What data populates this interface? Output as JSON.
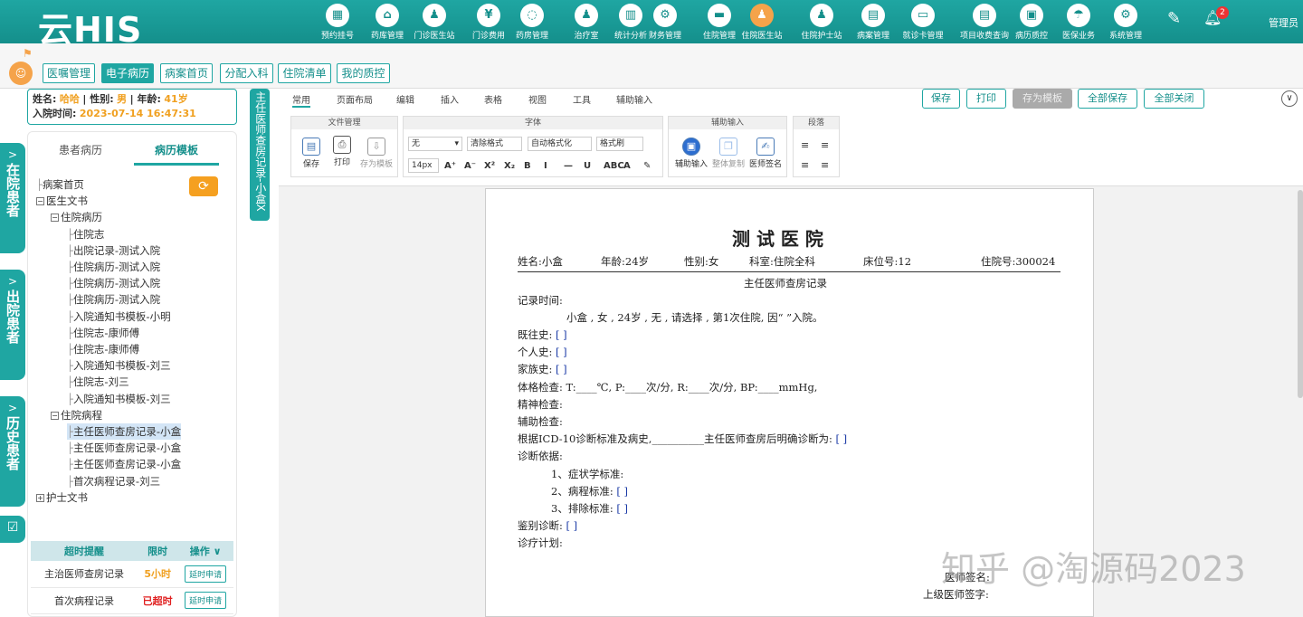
{
  "app": {
    "logo": "云HIS",
    "user": "管理员",
    "badge": "2"
  },
  "nav": [
    {
      "label": "预约挂号",
      "icon": "calendar-icon"
    },
    {
      "label": "药库管理",
      "icon": "warehouse-icon"
    },
    {
      "label": "门诊医生站",
      "icon": "doctor-icon"
    },
    {
      "label": "门诊费用",
      "icon": "yen-icon"
    },
    {
      "label": "药房管理",
      "icon": "pill-icon"
    },
    {
      "label": "治疗室",
      "icon": "nurse-icon"
    },
    {
      "label": "统计分析",
      "icon": "chart-icon"
    },
    {
      "label": "财务管理",
      "icon": "gear-money-icon"
    },
    {
      "label": "住院管理",
      "icon": "bed-icon"
    },
    {
      "label": "住院医生站",
      "icon": "inpatient-doctor-icon"
    },
    {
      "label": "住院护士站",
      "icon": "inpatient-nurse-icon"
    },
    {
      "label": "病案管理",
      "icon": "folder-icon"
    },
    {
      "label": "就诊卡管理",
      "icon": "card-icon"
    },
    {
      "label": "项目收费查询",
      "icon": "receipt-icon"
    },
    {
      "label": "病历质控",
      "icon": "clipboard-icon"
    },
    {
      "label": "医保业务",
      "icon": "insurance-icon"
    },
    {
      "label": "系统管理",
      "icon": "settings-icon"
    }
  ],
  "subtabs": [
    "医嘱管理",
    "电子病历",
    "病案首页",
    "分配入科",
    "住院清单",
    "我的质控"
  ],
  "patient": {
    "name_label": "姓名:",
    "name": "哈哈",
    "sex_label": "| 性别:",
    "sex": "男",
    "age_label": "| 年龄:",
    "age": "41岁",
    "admit_label": "入院时间:",
    "admit_time": "2023-07-14 16:47:31"
  },
  "side_tabs": [
    "在院患者",
    "出院患者",
    "历史患者"
  ],
  "left_tabs": [
    "患者病历",
    "病历模板"
  ],
  "tree": [
    {
      "label": "病案首页",
      "lvl": 0,
      "box": ""
    },
    {
      "label": "医生文书",
      "lvl": 0,
      "box": "⊟"
    },
    {
      "label": "住院病历",
      "lvl": 1,
      "box": "⊟"
    },
    {
      "label": "住院志",
      "lvl": 2,
      "box": ""
    },
    {
      "label": "出院记录-测试入院",
      "lvl": 2,
      "box": ""
    },
    {
      "label": "住院病历-测试入院",
      "lvl": 2,
      "box": ""
    },
    {
      "label": "住院病历-测试入院",
      "lvl": 2,
      "box": ""
    },
    {
      "label": "住院病历-测试入院",
      "lvl": 2,
      "box": ""
    },
    {
      "label": "入院通知书模板-小明",
      "lvl": 2,
      "box": ""
    },
    {
      "label": "住院志-康师傅",
      "lvl": 2,
      "box": ""
    },
    {
      "label": "住院志-康师傅",
      "lvl": 2,
      "box": ""
    },
    {
      "label": "入院通知书模板-刘三",
      "lvl": 2,
      "box": ""
    },
    {
      "label": "住院志-刘三",
      "lvl": 2,
      "box": ""
    },
    {
      "label": "入院通知书模板-刘三",
      "lvl": 2,
      "box": ""
    },
    {
      "label": "住院病程",
      "lvl": 1,
      "box": "⊟"
    },
    {
      "label": "主任医师查房记录-小盒",
      "lvl": 2,
      "box": "",
      "sel": true
    },
    {
      "label": "主任医师查房记录-小盒",
      "lvl": 2,
      "box": ""
    },
    {
      "label": "主任医师查房记录-小盒",
      "lvl": 2,
      "box": ""
    },
    {
      "label": "首次病程记录-刘三",
      "lvl": 2,
      "box": ""
    },
    {
      "label": "护士文书",
      "lvl": 0,
      "box": "⊞"
    }
  ],
  "alerts": {
    "headers": [
      "超时提醒",
      "限时",
      "操作 ∨"
    ],
    "rows": [
      {
        "name": "主治医师查房记录",
        "limit": "5小时",
        "limit_color": "#f0a020",
        "action": "延时申请"
      },
      {
        "name": "首次病程记录",
        "limit": "已超时",
        "limit_color": "#e02020",
        "action": "延时申请"
      }
    ]
  },
  "doc_tab": "主任医师查房记录-小盒X",
  "menus": [
    "常用",
    "页面布局",
    "编辑",
    "插入",
    "表格",
    "视图",
    "工具",
    "辅助输入"
  ],
  "top_buttons": [
    "保存",
    "打印",
    "存为模板",
    "全部保存",
    "全部关闭"
  ],
  "ribbon": {
    "file_group": "文件管理",
    "file_btns": [
      "保存",
      "打印",
      "存为模板"
    ],
    "font_group": "字体",
    "font_name": "无",
    "font_size": "14px",
    "font_btns": [
      "清除格式",
      "自动格式化",
      "格式刷"
    ],
    "font_marks": [
      "A⁺",
      "A⁻",
      "X²",
      "X₂",
      "B",
      "I",
      "—",
      "U",
      "ABC",
      "A",
      "✎"
    ],
    "assist_group": "辅助输入",
    "assist_btns": [
      "辅助输入",
      "整体复制",
      "医师签名"
    ],
    "para_group": "段落"
  },
  "document": {
    "hospital": "测 试 医 院",
    "header": [
      "姓名:小盒",
      "年龄:24岁",
      "性别:女",
      "科室:住院全科",
      "床位号:12",
      "住院号:300024"
    ],
    "title": "主任医师查房记录",
    "record_time": "记录时间:",
    "summary": "小盒 , 女 , 24岁 , 无 , 请选择 , 第1次住院, 因“ ”入院。",
    "lines": [
      {
        "text": "既往史:",
        "br": "[ ]"
      },
      {
        "text": "个人史:",
        "br": "[ ]"
      },
      {
        "text": "家族史:",
        "br": "[ ]"
      },
      {
        "text": "体格检查: T:____℃, P:____次/分, R:____次/分, BP:____mmHg,",
        "br": ""
      },
      {
        "text": "精神检查:",
        "br": ""
      },
      {
        "text": "辅助检查:",
        "br": ""
      },
      {
        "text": "根据ICD-10诊断标准及病史,__________主任医师查房后明确诊断为:",
        "br": "[ ]"
      },
      {
        "text": "诊断依据:",
        "br": ""
      },
      {
        "text": "1、症状学标准:",
        "br": "",
        "indent": true
      },
      {
        "text": "2、病程标准:",
        "br": "[ ]",
        "indent": true
      },
      {
        "text": "3、排除标准:",
        "br": "[ ]",
        "indent": true
      },
      {
        "text": "鉴别诊断:",
        "br": "[ ]"
      },
      {
        "text": "诊疗计划:",
        "br": ""
      }
    ],
    "sign1": "医师签名:",
    "sign2": "上级医师签字:"
  },
  "watermark": "知乎 @淘源码2023"
}
